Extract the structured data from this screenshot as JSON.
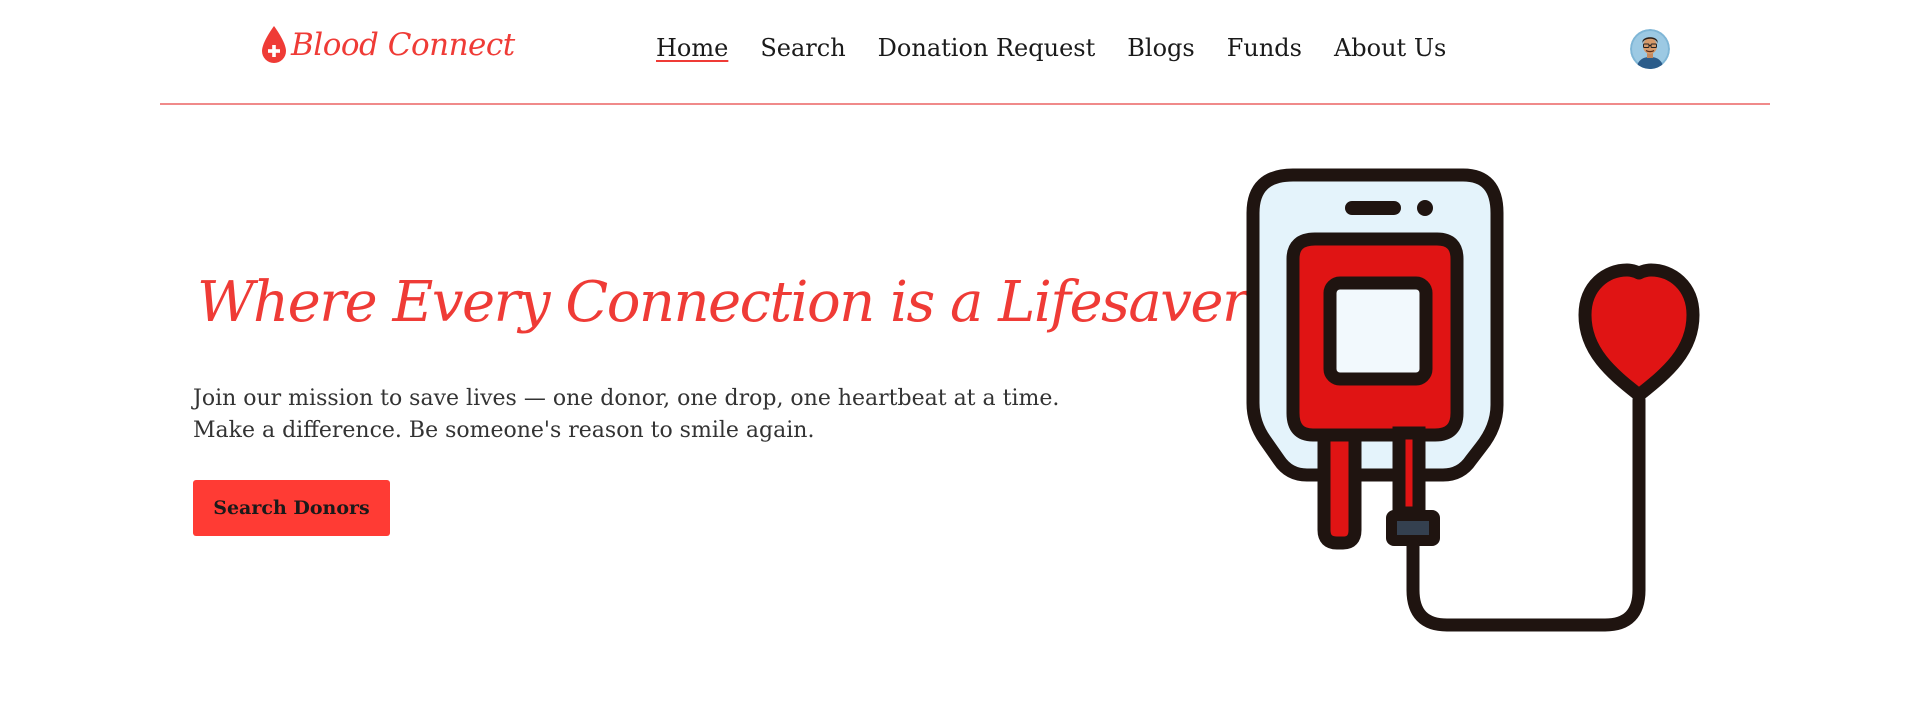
{
  "brand": {
    "name": "Blood Connect",
    "color": "#ef3b36"
  },
  "nav": {
    "items": [
      {
        "label": "Home",
        "active": true
      },
      {
        "label": "Search",
        "active": false
      },
      {
        "label": "Donation Request",
        "active": false
      },
      {
        "label": "Blogs",
        "active": false
      },
      {
        "label": "Funds",
        "active": false
      },
      {
        "label": "About Us",
        "active": false
      }
    ]
  },
  "user": {
    "avatar_icon": "user-avatar"
  },
  "hero": {
    "title": "Where Every Connection is a Lifesaver !",
    "line1": "Join our mission to save lives — one donor, one drop, one heartbeat at a time.",
    "line2": "Make a difference. Be someone's reason to smile again.",
    "cta_label": "Search Donors",
    "illustration_icon": "blood-bag-heart-icon"
  },
  "colors": {
    "accent": "#ef3b36",
    "button": "#ff3b34",
    "divider": "#f08a8a",
    "blood": "#e01414",
    "outline": "#1f1410",
    "bag_fill": "#e4f3fb"
  }
}
